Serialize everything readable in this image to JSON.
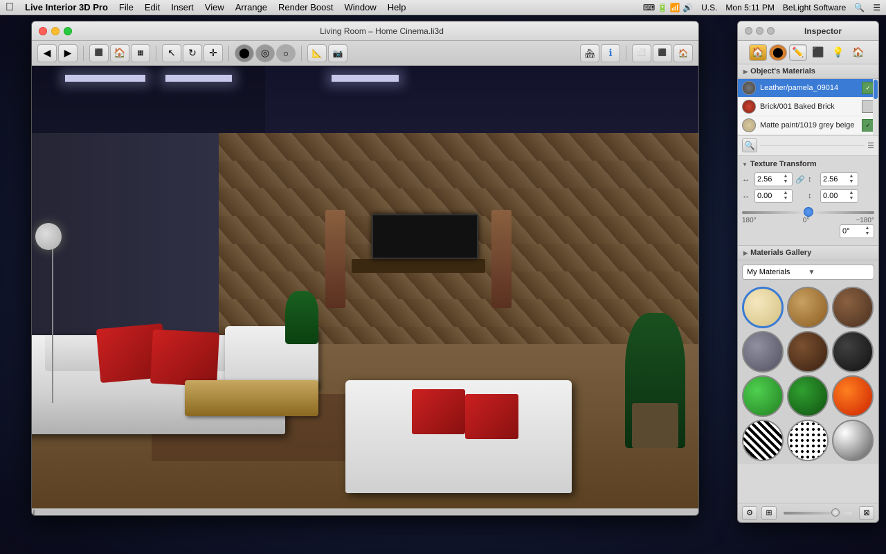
{
  "menubar": {
    "apple": "⌘",
    "app_name": "Live Interior 3D Pro",
    "menus": [
      "File",
      "Edit",
      "Insert",
      "View",
      "Arrange",
      "Render Boost",
      "Window",
      "Help"
    ],
    "right": {
      "time": "Mon 5:11 PM",
      "company": "BeLight Software",
      "locale": "U.S."
    }
  },
  "main_window": {
    "title": "Living Room – Home Cinema.li3d",
    "traffic_lights": {
      "red": "close",
      "yellow": "minimize",
      "green": "maximize"
    },
    "toolbar_buttons": [
      "back",
      "forward",
      "floor-plan",
      "render",
      "layers",
      "select",
      "rotate",
      "move",
      "orbit",
      "pan",
      "zoom",
      "measure",
      "camera",
      "top-view",
      "3d-view",
      "light",
      "info",
      "ortho",
      "iso",
      "home"
    ]
  },
  "inspector": {
    "title": "Inspector",
    "tabs": [
      {
        "name": "materials-tab",
        "icon": "🎨"
      },
      {
        "name": "object-tab",
        "icon": "⬡"
      },
      {
        "name": "edit-tab",
        "icon": "✏️"
      },
      {
        "name": "texture-tab",
        "icon": "🔲"
      },
      {
        "name": "light-tab",
        "icon": "💡"
      },
      {
        "name": "room-tab",
        "icon": "🏠"
      }
    ],
    "traffic_lights": {
      "btn1": "close",
      "btn2": "minimize",
      "btn3": "maximize"
    },
    "objects_materials": {
      "section_title": "Object's Materials",
      "items": [
        {
          "name": "Leather/pamela_09014",
          "swatch_color": "#555555",
          "selected": true
        },
        {
          "name": "Brick/001 Baked Brick",
          "swatch_color": "#cc3322"
        },
        {
          "name": "Matte paint/1019 grey beige",
          "swatch_color": "#d4c8a0"
        }
      ]
    },
    "texture_transform": {
      "section_title": "Texture Transform",
      "width_value": "2.56",
      "height_value": "2.56",
      "offset_x": "0.00",
      "offset_y": "0.00",
      "rotation_value": "0°",
      "rotation_min": "180°",
      "rotation_center": "0°",
      "rotation_max": "−180°"
    },
    "materials_gallery": {
      "section_title": "Materials Gallery",
      "dropdown_label": "My Materials",
      "items": [
        {
          "name": "cream",
          "class": "mat-cream",
          "selected": true
        },
        {
          "name": "wood-light",
          "class": "mat-wood-light"
        },
        {
          "name": "wood-dark",
          "class": "mat-wood-dark"
        },
        {
          "name": "stone",
          "class": "mat-stone"
        },
        {
          "name": "brown-dark",
          "class": "mat-brown-dark"
        },
        {
          "name": "dark",
          "class": "mat-dark"
        },
        {
          "name": "green-bright",
          "class": "mat-green-bright"
        },
        {
          "name": "green-dark",
          "class": "mat-green-dark"
        },
        {
          "name": "fire",
          "class": "mat-fire"
        },
        {
          "name": "zebra",
          "class": "mat-zebra"
        },
        {
          "name": "spots",
          "class": "mat-spots"
        },
        {
          "name": "chrome",
          "class": "mat-chrome"
        }
      ]
    }
  }
}
